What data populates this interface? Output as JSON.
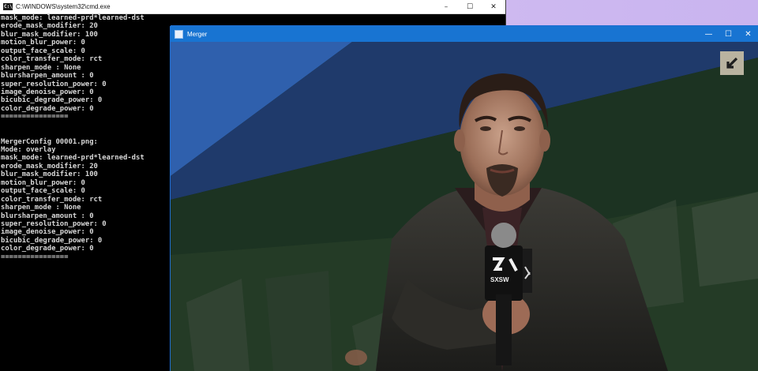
{
  "cmd": {
    "title": "C:\\WINDOWS\\system32\\cmd.exe",
    "controls": {
      "minimize": "–",
      "maximize": "☐",
      "close": "✕"
    },
    "lines": [
      "mask_mode: learned-prd*learned-dst",
      "erode_mask_modifier: 20",
      "blur_mask_modifier: 100",
      "motion_blur_power: 0",
      "output_face_scale: 0",
      "color_transfer_mode: rct",
      "sharpen_mode : None",
      "blursharpen_amount : 0",
      "super_resolution_power: 0",
      "image_denoise_power: 0",
      "bicubic_degrade_power: 0",
      "color_degrade_power: 0",
      "================",
      "",
      "",
      "MergerConfig 00001.png:",
      "Mode: overlay",
      "mask_mode: learned-prd*learned-dst",
      "erode_mask_modifier: 20",
      "blur_mask_modifier: 100",
      "motion_blur_power: 0",
      "output_face_scale: 0",
      "color_transfer_mode: rct",
      "sharpen_mode : None",
      "blursharpen_amount : 0",
      "super_resolution_power: 0",
      "image_denoise_power: 0",
      "bicubic_degrade_power: 0",
      "color_degrade_power: 0",
      "================"
    ]
  },
  "merger": {
    "title": "Merger",
    "controls": {
      "minimize": "—",
      "maximize": "☐",
      "close": "✕"
    },
    "mic_logo_text": "SXSW"
  },
  "colors": {
    "cmd_bg": "#000000",
    "cmd_text": "#d8d8d8",
    "merger_titlebar": "#1874d2",
    "desktop": "#d0bcf2"
  }
}
